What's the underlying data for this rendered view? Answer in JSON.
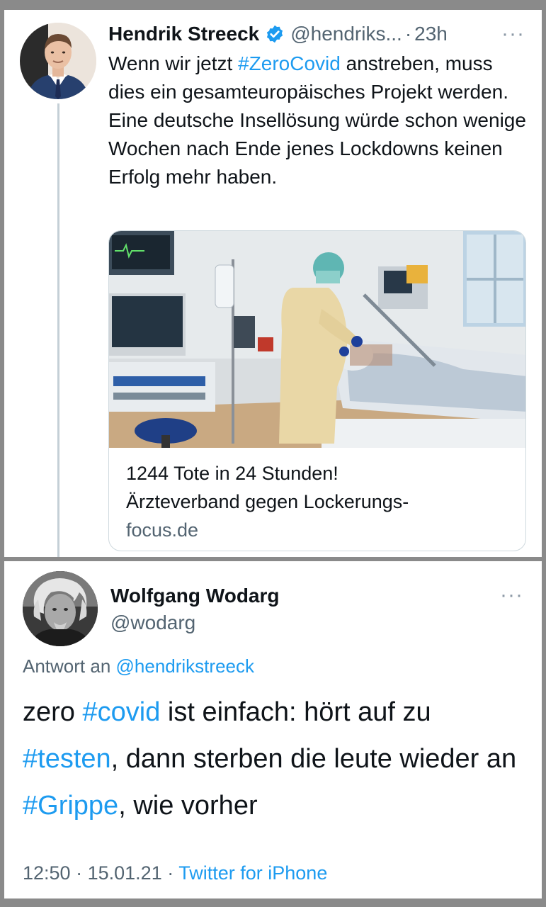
{
  "tweet": {
    "author_name": "Hendrik Streeck",
    "handle": "@hendriks...",
    "separator": "·",
    "time": "23h",
    "more": "···",
    "verified_icon": "verified-badge-icon",
    "text_parts": [
      "Wenn wir jetzt ",
      "#ZeroCovid",
      " anstreben, muss dies ein gesamteuropäisches Projekt werden. Eine deutsche Insellösung würde schon wenige Wochen nach Ende jenes Lockdowns keinen Erfolg mehr haben."
    ],
    "card": {
      "headline_line1": "1244 Tote in 24 Stunden!",
      "headline_line2": "Ärzteverband gegen Lockerungs-",
      "domain": "focus.de"
    }
  },
  "reply": {
    "author_name": "Wolfgang Wodarg",
    "handle": "@wodarg",
    "more": "···",
    "reply_prefix": "Antwort an ",
    "reply_mention": "@hendrikstreeck",
    "text_parts": [
      "zero ",
      "#covid",
      " ist einfach: hört auf zu ",
      "#testen",
      ", dann sterben die leute wieder an ",
      "#Grippe",
      ", wie vorher"
    ],
    "time": "12:50",
    "separator": "·",
    "date": "15.01.21",
    "source": "Twitter for iPhone"
  },
  "colors": {
    "link": "#1d9bf0",
    "secondary_text": "#536471",
    "primary_text": "#0f1419"
  }
}
